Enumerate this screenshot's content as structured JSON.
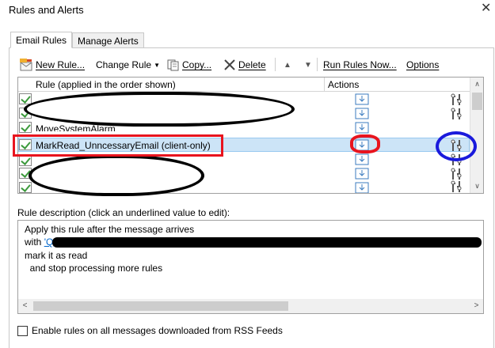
{
  "window": {
    "title": "Rules and Alerts"
  },
  "tabs": [
    {
      "label": "Email Rules",
      "active": true
    },
    {
      "label": "Manage Alerts",
      "active": false
    }
  ],
  "toolbar": {
    "new_rule": "New Rule...",
    "change_rule": "Change Rule",
    "copy": "Copy...",
    "delete": "Delete",
    "run_rules_now": "Run Rules Now...",
    "options": "Options"
  },
  "rules_list": {
    "col_rule": "Rule (applied in the order shown)",
    "col_actions": "Actions",
    "rows": [
      {
        "label": "",
        "checked": true
      },
      {
        "label": "",
        "checked": true
      },
      {
        "label": "MoveSystemAlarm",
        "checked": true
      },
      {
        "label": "MarkRead_UnncessaryEmail  (client-only)",
        "checked": true,
        "selected": true
      },
      {
        "label": "",
        "checked": true
      },
      {
        "label": "",
        "checked": true
      },
      {
        "label": "",
        "checked": true
      }
    ]
  },
  "description": {
    "label": "Rule description (click an underlined value to edit):",
    "lines": {
      "l1": "Apply this rule after the message arrives",
      "l2_prefix": "with ",
      "l2_link": "'Q",
      "l3": "mark it as read",
      "l4": "  and stop processing more rules"
    }
  },
  "rss": {
    "label": "Enable rules on all messages downloaded from RSS Feeds",
    "checked": false
  },
  "colors": {
    "selected_row": "#cce4f7",
    "annotation_red": "#e8141e",
    "annotation_blue": "#1a1adc",
    "link": "#0066cc"
  }
}
